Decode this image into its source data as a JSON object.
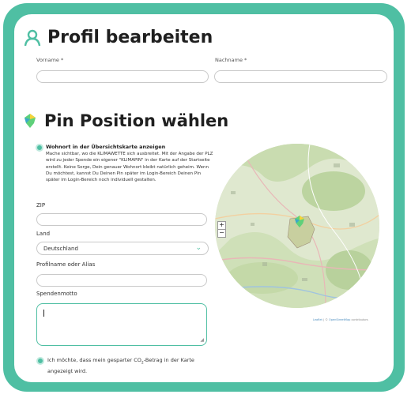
{
  "profile": {
    "title": "Profil bearbeiten",
    "vorname_label": "Vorname *",
    "nachname_label": "Nachname *"
  },
  "pin": {
    "title": "Pin Position wählen",
    "radio_title": "Wohnort in der Übersichtskarte anzeigen",
    "radio_desc": "Mache sichtbar, wo die KLIMAWETTE sich ausbreitet. Mit der Angabe der PLZ wird zu jeder Spende ein eigener \"KLIMAPIN\" in der Karte auf der Startseite erstellt. Keine Sorge, Dein genauer Wohnort bleibt natürlich geheim. Wenn Du möchtest, kannst Du Deinen Pin später im Login-Bereich Deinen Pin später im Login-Bereich noch individuell gestalten."
  },
  "form": {
    "zip_label": "ZIP",
    "land_label": "Land",
    "land_value": "Deutschland",
    "alias_label": "Profilname oder Alias",
    "motto_label": "Spendenmotto",
    "co2_check_before": "Ich möchte, dass mein gesparter CO",
    "co2_check_sub": "2",
    "co2_check_after": "-Betrag in der Karte angezeigt wird."
  },
  "map": {
    "zoom_in": "+",
    "zoom_out": "−",
    "attribution_leaflet": "Leaflet",
    "attribution_sep": " | © ",
    "attribution_osm": "OpenStreetMap",
    "attribution_tail": " contributors"
  },
  "colors": {
    "accent": "#4fbfa3",
    "pin": "#5fd07a"
  }
}
